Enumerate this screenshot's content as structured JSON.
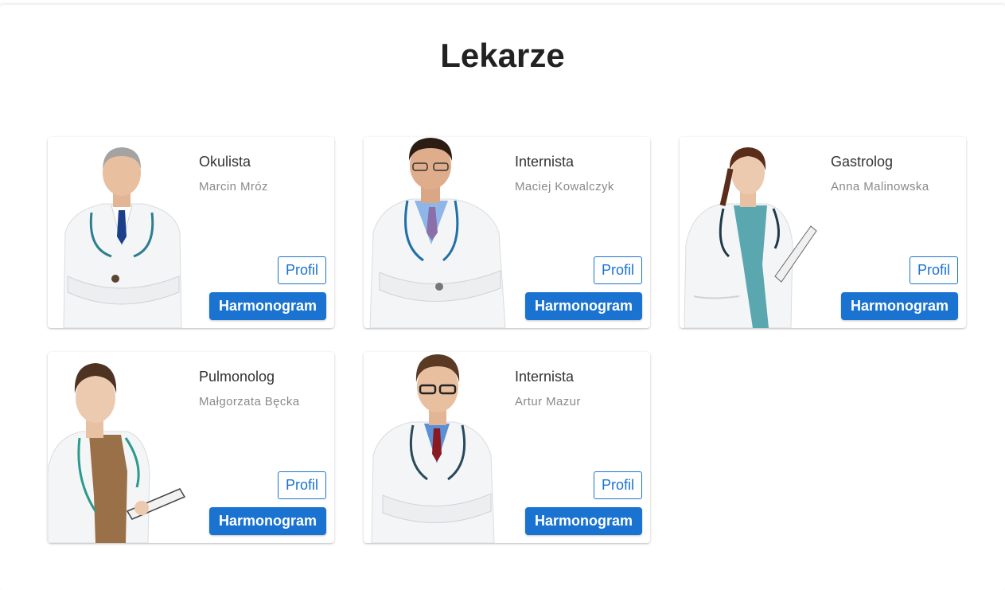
{
  "page": {
    "title": "Lekarze"
  },
  "colors": {
    "accent": "#1a73d1",
    "title": "#222222",
    "muted": "#8a8a8a"
  },
  "doctors": [
    {
      "specialty": "Okulista",
      "name": "Marcin Mróz",
      "profile_label": "Profil",
      "schedule_label": "Harmonogram",
      "photo": "doctor-photo-male-grey-hair"
    },
    {
      "specialty": "Internista",
      "name": "Maciej Kowalczyk",
      "profile_label": "Profil",
      "schedule_label": "Harmonogram",
      "photo": "doctor-photo-male-dark-hair-glasses"
    },
    {
      "specialty": "Gastrolog",
      "name": "Anna Malinowska",
      "profile_label": "Profil",
      "schedule_label": "Harmonogram",
      "photo": "doctor-photo-female-clipboard"
    },
    {
      "specialty": "Pulmonolog",
      "name": "Małgorzata Bęcka",
      "profile_label": "Profil",
      "schedule_label": "Harmonogram",
      "photo": "doctor-photo-female-tablet"
    },
    {
      "specialty": "Internista",
      "name": "Artur Mazur",
      "profile_label": "Profil",
      "schedule_label": "Harmonogram",
      "photo": "doctor-photo-male-smiling-glasses"
    }
  ]
}
